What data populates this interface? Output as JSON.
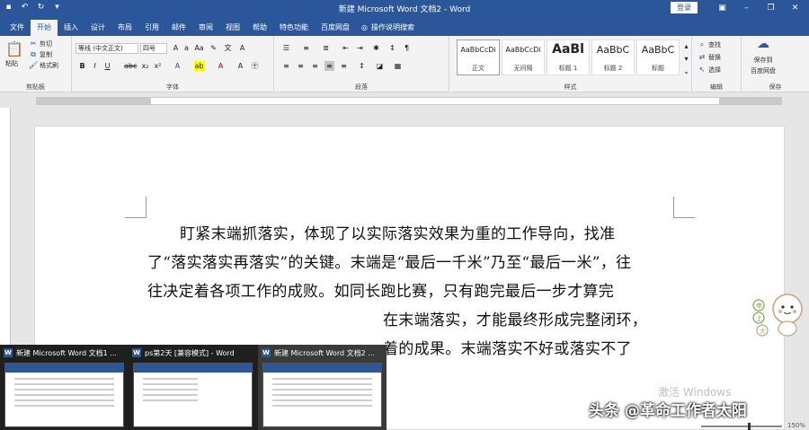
{
  "titlebar": {
    "title": "新建 Microsoft Word 文档2 - Word",
    "signin": "登录"
  },
  "tabs": [
    "文件",
    "开始",
    "插入",
    "设计",
    "布局",
    "引用",
    "邮件",
    "审阅",
    "视图",
    "帮助",
    "特色功能",
    "百度网盘"
  ],
  "tell_me": "操作说明搜索",
  "ribbon": {
    "clipboard": {
      "paste": "粘贴",
      "cut": "剪切",
      "copy": "复制",
      "format_painter": "格式刷",
      "label": "剪贴板"
    },
    "font": {
      "font_name": "等线 (中文正文)",
      "font_size": "四号",
      "label": "字体"
    },
    "paragraph": {
      "label": "段落"
    },
    "styles": {
      "items": [
        {
          "sample": "AaBbCcDi",
          "name": "正文"
        },
        {
          "sample": "AaBbCcDi",
          "name": "无间隔"
        },
        {
          "sample": "AaBl",
          "name": "标题 1"
        },
        {
          "sample": "AaBbC",
          "name": "标题 2"
        },
        {
          "sample": "AaBbC",
          "name": "标题"
        }
      ],
      "label": "样式"
    },
    "editing": {
      "find": "查找",
      "replace": "替换",
      "select": "选择",
      "label": "编辑"
    },
    "save": {
      "line1": "保存到",
      "line2": "百度网盘",
      "label": "保存"
    }
  },
  "document": {
    "lines": [
      "盯紧末端抓落实，体现了以实际落实效果为重的工作导向，找准",
      "了“落实落实再落实”的关键。末端是“最后一千米”乃至“最后一米”，往",
      "往决定着各项工作的成败。如同长跑比赛，只有跑完最后一步才算完",
      "在末端落实，才能最终形成完整闭环，",
      "着的成果。末端落实不好或落实不了"
    ]
  },
  "taskbar_thumbs": [
    {
      "title": "新建 Microsoft Word 文档1 ..."
    },
    {
      "title": "ps第2天 [兼容模式] - Word"
    },
    {
      "title": "新建 Microsoft Word 文档2 ..."
    }
  ],
  "overlay": {
    "activate": "激活 Windows",
    "watermark": "头条 @革命工作者太阳",
    "zoom": "150%"
  },
  "colors": {
    "accent": "#2b579a"
  }
}
